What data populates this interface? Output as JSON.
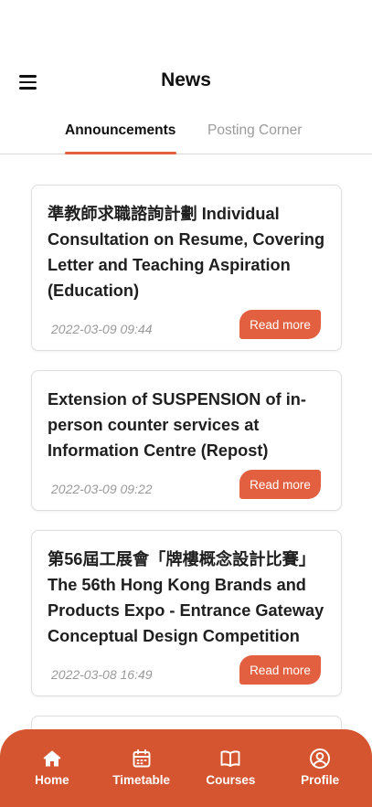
{
  "header": {
    "title": "News"
  },
  "tabs": [
    {
      "label": "Announcements",
      "active": true
    },
    {
      "label": "Posting Corner",
      "active": false
    }
  ],
  "news": [
    {
      "title": "準教師求職諮詢計劃 Individual Consultation on Resume, Covering Letter and Teaching Aspiration (Education)",
      "date": "2022-03-09 09:44",
      "action": "Read more"
    },
    {
      "title": "Extension of SUSPENSION of in-person counter services at Information Centre (Repost)",
      "date": "2022-03-09 09:22",
      "action": "Read more"
    },
    {
      "title": "第56屆工展會「牌樓概念設計比賽」The 56th Hong Kong Brands and Products Expo - Entrance Gateway Conceptual Design Competition",
      "date": "2022-03-08 16:49",
      "action": "Read more"
    }
  ],
  "nav": [
    {
      "label": "Home",
      "icon": "home-icon"
    },
    {
      "label": "Timetable",
      "icon": "calendar-icon"
    },
    {
      "label": "Courses",
      "icon": "book-icon"
    },
    {
      "label": "Profile",
      "icon": "user-icon"
    }
  ],
  "colors": {
    "accent": "#e2603f",
    "nav_bg": "#d4552f"
  }
}
